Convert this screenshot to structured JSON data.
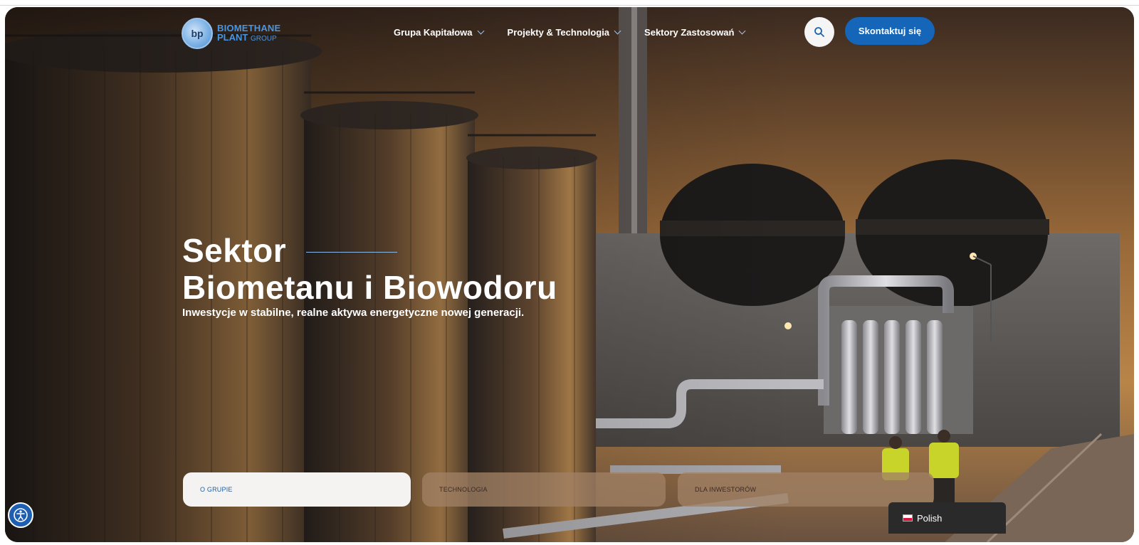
{
  "header": {
    "logo": {
      "badge": "bp",
      "line1": "BIOMETHANE",
      "line2": "PLANT",
      "line2_small": "GROUP"
    },
    "nav": [
      {
        "label": "Grupa Kapitałowa"
      },
      {
        "label": "Projekty & Technologia"
      },
      {
        "label": "Sektory Zastosowań"
      }
    ],
    "search_icon": "search-icon",
    "contact_label": "Skontaktuj się"
  },
  "hero": {
    "title_line1": "Sektor",
    "title_line2": "Biometanu i Biowodoru",
    "subtitle": "Inwestycje w stabilne, realne aktywa energetyczne nowej generacji."
  },
  "tabs": [
    {
      "label": "O GRUPIE",
      "active": true
    },
    {
      "label": "TECHNOLOGIA",
      "active": false
    },
    {
      "label": "DLA INWESTORÓW",
      "active": false
    }
  ],
  "accessibility_icon": "accessibility-icon",
  "language": {
    "label": "Polish",
    "flag": "poland-flag-icon"
  },
  "colors": {
    "accent": "#1565b8",
    "logo": "#4a95e0",
    "tab_active_text": "#1f5ea8"
  }
}
